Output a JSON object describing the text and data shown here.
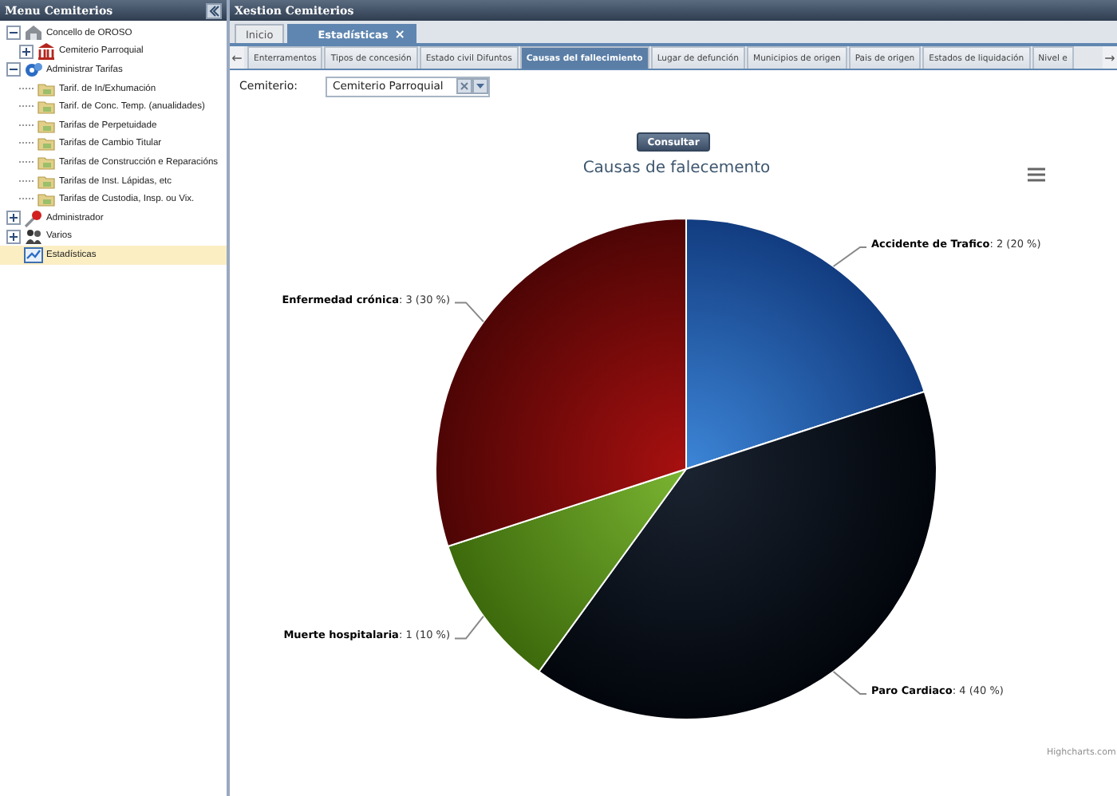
{
  "sidebar": {
    "title": "Menu Cemiterios",
    "tree": [
      {
        "label": "Concello de OROSO",
        "kind": "building",
        "expanded": true,
        "selected": false,
        "children": [
          {
            "label": "Cemiterio Parroquial",
            "kind": "temple",
            "expanded": false,
            "selected": false
          }
        ]
      },
      {
        "label": "Administrar Tarifas",
        "kind": "gear",
        "expanded": true,
        "selected": false,
        "children": [
          {
            "label": "Tarif. de In/Exhumación",
            "kind": "folder",
            "selected": false
          },
          {
            "label": "Tarif. de Conc. Temp. (anualidades)",
            "kind": "folder",
            "selected": false
          },
          {
            "label": "Tarifas de Perpetuidade",
            "kind": "folder",
            "selected": false
          },
          {
            "label": "Tarifas de Cambio Titular",
            "kind": "folder",
            "selected": false
          },
          {
            "label": "Tarifas de Construcción e Reparacións",
            "kind": "folder",
            "selected": false
          },
          {
            "label": "Tarifas de Inst. Lápidas, etc",
            "kind": "folder",
            "selected": false
          },
          {
            "label": "Tarifas de Custodia, Insp. ou Vix.",
            "kind": "folder",
            "selected": false
          }
        ]
      },
      {
        "label": "Administrador",
        "kind": "tools",
        "expanded": false,
        "selected": false
      },
      {
        "label": "Varios",
        "kind": "people",
        "expanded": false,
        "selected": false
      },
      {
        "label": "Estadísticas",
        "kind": "chart",
        "selected": true
      }
    ]
  },
  "main": {
    "title": "Xestion Cemiterios",
    "doc_tabs": [
      {
        "label": "Inicio",
        "selected": false
      },
      {
        "label": "Estadísticas",
        "selected": true,
        "close_icon": "×"
      }
    ],
    "scroll_left": "←",
    "scroll_right": "→",
    "report_tabs": [
      {
        "label": "Enterramentos",
        "selected": false
      },
      {
        "label": "Tipos de concesión",
        "selected": false
      },
      {
        "label": "Estado civil Difuntos",
        "selected": false
      },
      {
        "label": "Causas del fallecimiento",
        "selected": true
      },
      {
        "label": "Lugar de defunción",
        "selected": false
      },
      {
        "label": "Municipios de origen",
        "selected": false
      },
      {
        "label": "Pais de origen",
        "selected": false
      },
      {
        "label": "Estados de liquidación",
        "selected": false
      },
      {
        "label": "Nivel e",
        "selected": false
      }
    ],
    "filter": {
      "label": "Cemiterio:",
      "value": "Cemiterio Parroquial"
    },
    "submit_button": "Consultar",
    "chart": {
      "credit": "Highcharts.com",
      "chart_data": {
        "type": "pie",
        "title": "Causas de falecemento",
        "categories": [
          "Accidente de Trafico",
          "Paro Cardiaco",
          "Muerte hospitalaria",
          "Enfermedad crónica"
        ],
        "values": [
          2,
          4,
          1,
          3
        ],
        "value_labels": [
          ": 2 (20 %)",
          ": 4 (40 %)",
          ": 1 (10 %)",
          ": 3 (30 %)"
        ]
      }
    }
  }
}
